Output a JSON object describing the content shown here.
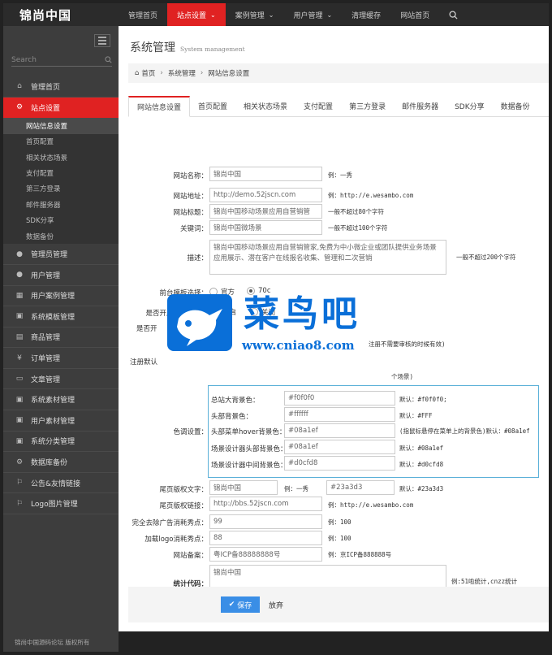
{
  "app": {
    "logo": "锦尚中国"
  },
  "topnav": [
    {
      "label": "管理首页",
      "active": false,
      "caret": false
    },
    {
      "label": "站点设置",
      "active": true,
      "caret": true
    },
    {
      "label": "案例管理",
      "active": false,
      "caret": true
    },
    {
      "label": "用户管理",
      "active": false,
      "caret": true
    },
    {
      "label": "清理缓存",
      "active": false,
      "caret": false
    },
    {
      "label": "网站首页",
      "active": false,
      "caret": false
    }
  ],
  "sidebar": {
    "search_placeholder": "Search",
    "items": [
      {
        "label": "管理首页",
        "icon": "home-icon"
      },
      {
        "label": "站点设置",
        "icon": "gears-icon",
        "active": true
      },
      {
        "label": "管理员管理",
        "icon": "user-icon"
      },
      {
        "label": "用户管理",
        "icon": "user-icon"
      },
      {
        "label": "用户案例管理",
        "icon": "table-icon"
      },
      {
        "label": "系统模板管理",
        "icon": "briefcase-icon"
      },
      {
        "label": "商品管理",
        "icon": "box-icon"
      },
      {
        "label": "订单管理",
        "icon": "yen-icon"
      },
      {
        "label": "文章管理",
        "icon": "article-icon"
      },
      {
        "label": "系统素材管理",
        "icon": "briefcase-icon"
      },
      {
        "label": "用户素材管理",
        "icon": "briefcase-icon"
      },
      {
        "label": "系统分类管理",
        "icon": "briefcase-icon"
      },
      {
        "label": "数据库备份",
        "icon": "gears-icon"
      },
      {
        "label": "公告&友情链接",
        "icon": "bookmark-icon"
      },
      {
        "label": "Logo图片管理",
        "icon": "bookmark-icon"
      }
    ],
    "subitems": [
      "网站信息设置",
      "首页配置",
      "相关状态场景",
      "支付配置",
      "第三方登录",
      "邮件服务器",
      "SDK分享",
      "数据备份"
    ],
    "footer": "锦尚中国源码论坛 版权所有"
  },
  "page": {
    "title": "系统管理",
    "title_en": "System management",
    "breadcrumb": [
      "首页",
      "系统管理",
      "网站信息设置"
    ],
    "tabs": [
      "网站信息设置",
      "首页配置",
      "相关状态场景",
      "支付配置",
      "第三方登录",
      "邮件服务器",
      "SDK分享",
      "数据备份"
    ]
  },
  "form": {
    "site_name": {
      "label": "网站名称：",
      "value": "锦尚中国",
      "hint": "例：一秀"
    },
    "site_url": {
      "label": "网站地址：",
      "value": "http://demo.52jscn.com",
      "hint": "例：http://e.wesambo.com"
    },
    "site_title": {
      "label": "网站标题：",
      "value": "锦尚中国移动场景应用自营销管",
      "hint": "一般不超过80个字符"
    },
    "keywords": {
      "label": "关键词：",
      "value": "锦尚中国微场景",
      "hint": "一般不超过100个字符"
    },
    "description": {
      "label": "描述：",
      "value": "锦尚中国移动场景应用自营销管家,免费为中小微企业或团队提供业务场景应用展示、潜在客户在线报名收集、管理和二次营销",
      "hint": "一般不超过200个字符"
    },
    "template": {
      "label": "前台模板选择：",
      "opt1": "官方",
      "opt2": "70c"
    },
    "register": {
      "label": "是否开启会员注册：",
      "opt1": "开启",
      "opt2": "关闭"
    },
    "review_label": "是否开",
    "review_hint": "注册不需要审核的时候有效)",
    "default_label": "注册默认",
    "default_hint": "个场景)",
    "colors": {
      "label": "色调设置：",
      "rows": [
        {
          "label": "总站大背景色：",
          "value": "#f0f0f0",
          "hint": "默认：#f0f0f0;"
        },
        {
          "label": "头部背景色：",
          "value": "#ffffff",
          "hint": "默认：#FFF"
        },
        {
          "label": "头部菜单hover背景色：",
          "value": "#08a1ef",
          "hint": "(指鼠标悬停在菜单上的背景色)默认：#08a1ef"
        },
        {
          "label": "场景设计器头部背景色：",
          "value": "#08a1ef",
          "hint": "默认：#08a1ef"
        },
        {
          "label": "场景设计器中间背景色：",
          "value": "#d0cfd8",
          "hint": "默认：#d0cfd8"
        }
      ]
    },
    "footer_text": {
      "label": "尾页版权文字：",
      "value": "锦尚中国",
      "hint": "例：一秀",
      "color_value": "#23a3d3",
      "color_hint": "默认：#23a3d3"
    },
    "footer_link": {
      "label": "尾页版权链接：",
      "value": "http://bbs.52jscn.com",
      "hint": "例：http://e.wesambo.com"
    },
    "ad_points": {
      "label": "完全去除广告消耗秀点：",
      "value": "99",
      "hint": "例：100"
    },
    "logo_points": {
      "label": "加载logo消耗秀点：",
      "value": "88",
      "hint": "例：100"
    },
    "icp": {
      "label": "网站备案：",
      "value": "粤ICP备88888888号",
      "hint": "例：京ICP备888888号"
    },
    "stats": {
      "label": "统计代码：",
      "value": "锦尚中国",
      "hint": "例:51啦统计,cnzz统计"
    }
  },
  "actions": {
    "save": "保存",
    "cancel": "放弃"
  },
  "watermark": {
    "title": "菜鸟吧",
    "url": "www.cniao8.com"
  }
}
